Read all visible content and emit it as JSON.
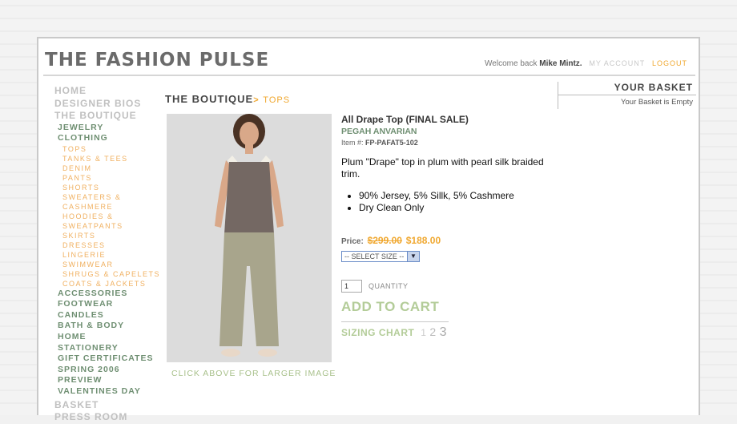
{
  "header": {
    "logo": "THE FASHION PULSE",
    "welcome_prefix": "Welcome back",
    "user_name": "Mike Mintz.",
    "my_account": "MY ACCOUNT",
    "logout": "LOGOUT"
  },
  "nav": {
    "top_items": [
      "HOME",
      "DESIGNER BIOS",
      "THE BOUTIQUE"
    ],
    "categories_a": [
      "JEWELRY",
      "CLOTHING"
    ],
    "clothing_sub": [
      "TOPS",
      "TANKS & TEES",
      "DENIM",
      "PANTS",
      "SHORTS",
      "SWEATERS &",
      "CASHMERE",
      "HOODIES &",
      "SWEATPANTS",
      "SKIRTS",
      "DRESSES",
      "LINGERIE",
      "SWIMWEAR",
      "SHRUGS & CAPELETS",
      "COATS & JACKETS"
    ],
    "categories_b": [
      "ACCESSORIES",
      "FOOTWEAR",
      "CANDLES",
      "BATH & BODY",
      "HOME",
      "STATIONERY",
      "GIFT CERTIFICATES",
      "SPRING 2006",
      "PREVIEW",
      "VALENTINES DAY"
    ],
    "bottom_items": [
      "BASKET",
      "PRESS ROOM"
    ]
  },
  "breadcrumb": {
    "section": "THE BOUTIQUE",
    "separator": ">",
    "current": "TOPS"
  },
  "photo_caption": "CLICK ABOVE FOR LARGER IMAGE",
  "product": {
    "title": "All Drape Top (FINAL SALE)",
    "designer": "PEGAH ANVARIAN",
    "item_label": "Item #:",
    "item_number": "FP-PAFAT5-102",
    "description": "Plum \"Drape\" top in plum with pearl silk braided trim.",
    "features": [
      "90% Jersey, 5% Sillk, 5% Cashmere",
      "Dry Clean Only"
    ],
    "price_label": "Price:",
    "price_old": "$299.00",
    "price_new": "$188.00",
    "size_select": "-- SELECT SIZE --",
    "quantity_value": "1",
    "quantity_label": "QUANTITY",
    "add_to_cart": "ADD TO CART",
    "sizing_chart": "SIZING CHART",
    "sizing_numbers": [
      "1",
      "2",
      "3"
    ]
  },
  "basket": {
    "title": "YOUR BASKET",
    "status": "Your Basket is Empty"
  },
  "colors": {
    "accent_orange": "#f0a830",
    "nav_green": "#6f8f72",
    "cta_green": "#b3cc98"
  }
}
